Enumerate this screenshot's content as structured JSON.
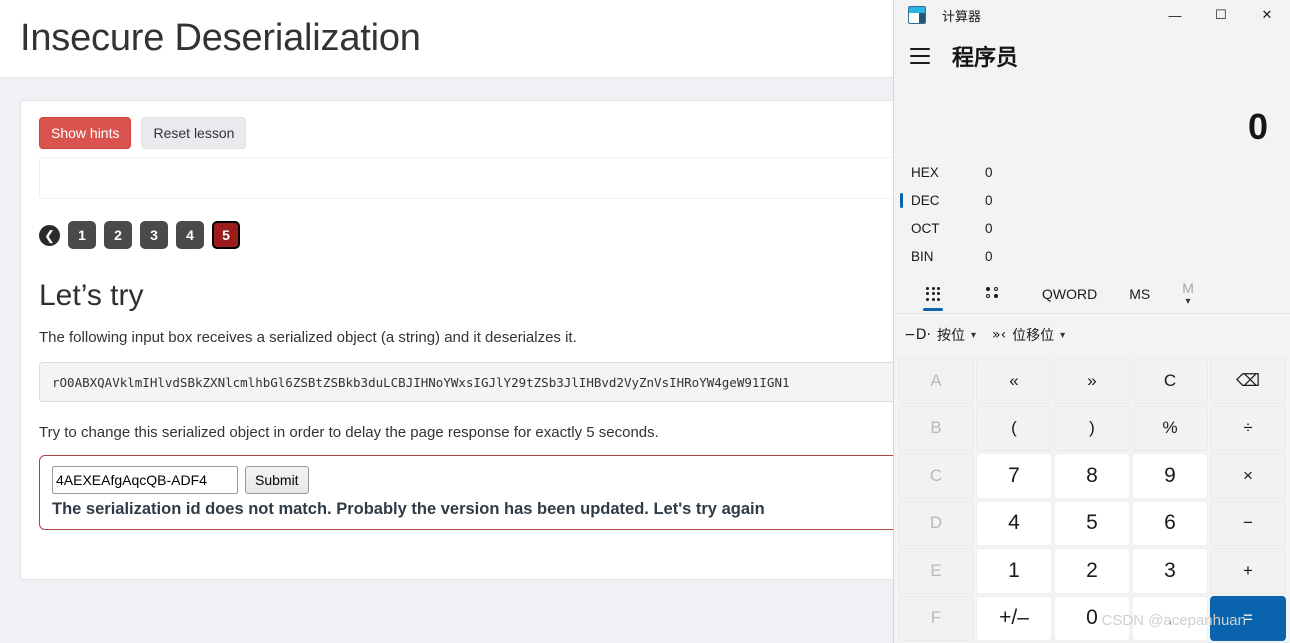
{
  "page": {
    "title": "Insecure Deserialization",
    "hints_button": "Show hints",
    "reset_button": "Reset lesson",
    "pager": {
      "back_icon": "⬅",
      "items": [
        "1",
        "2",
        "3",
        "4",
        "5"
      ],
      "active": "5"
    },
    "section_title": "Let’s try",
    "paragraph1": "The following input box receives a serialized object (a string) and it deserialzes it.",
    "serialized_object": "rO0ABXQAVklmIHlvdSBkZXNlcmlhbGl6ZSBtZSBkb3duLCBJIHNoYWxsIGJlY29tZSb3JlIHBvd2VyZnVsIHRoYW4geW91IGN1",
    "paragraph2": "Try to change this serialized object in order to delay the page response for exactly 5 seconds.",
    "attack_input_value": "4AEXEAfgAqcQB-ADF4",
    "submit_button": "Submit",
    "error_message": "The serialization id does not match. Probably the version has been updated. Let's try again",
    "accent_red": "#d9534f",
    "error_border": "#a94442"
  },
  "calculator": {
    "app_name": "计算器",
    "window_controls": {
      "minimize": "—",
      "maximize": "☐",
      "close": "✕"
    },
    "mode_label": "程序员",
    "display_value": "0",
    "radix": [
      {
        "name": "HEX",
        "value": "0",
        "active": false
      },
      {
        "name": "DEC",
        "value": "0",
        "active": true
      },
      {
        "name": "OCT",
        "value": "0",
        "active": false
      },
      {
        "name": "BIN",
        "value": "0",
        "active": false
      }
    ],
    "tabs": [
      {
        "label": "",
        "icon": "keypad-icon",
        "selected": true,
        "disabled": false
      },
      {
        "label": "",
        "icon": "bit-toggle-icon",
        "selected": false,
        "disabled": false
      },
      {
        "label": "QWORD",
        "icon": "",
        "selected": false,
        "disabled": false
      },
      {
        "label": "MS",
        "icon": "",
        "selected": false,
        "disabled": false
      },
      {
        "label": "M",
        "icon": "chevron-down-icon",
        "selected": false,
        "disabled": true
      }
    ],
    "ops": [
      {
        "label": "按位",
        "icon": "logic-gate-icon"
      },
      {
        "label": "位移位",
        "icon": "bit-shift-icon"
      }
    ],
    "keys": [
      {
        "label": "A",
        "type": "hexdim"
      },
      {
        "label": "«",
        "type": "fn"
      },
      {
        "label": "»",
        "type": "fn"
      },
      {
        "label": "C",
        "type": "fn"
      },
      {
        "label": "⌫",
        "type": "fn"
      },
      {
        "label": "B",
        "type": "hexdim"
      },
      {
        "label": "(",
        "type": "fn"
      },
      {
        "label": ")",
        "type": "fn"
      },
      {
        "label": "%",
        "type": "fn"
      },
      {
        "label": "÷",
        "type": "fn"
      },
      {
        "label": "C",
        "type": "hexdim"
      },
      {
        "label": "7",
        "type": "num"
      },
      {
        "label": "8",
        "type": "num"
      },
      {
        "label": "9",
        "type": "num"
      },
      {
        "label": "×",
        "type": "fn"
      },
      {
        "label": "D",
        "type": "hexdim"
      },
      {
        "label": "4",
        "type": "num"
      },
      {
        "label": "5",
        "type": "num"
      },
      {
        "label": "6",
        "type": "num"
      },
      {
        "label": "−",
        "type": "fn"
      },
      {
        "label": "E",
        "type": "hexdim"
      },
      {
        "label": "1",
        "type": "num"
      },
      {
        "label": "2",
        "type": "num"
      },
      {
        "label": "3",
        "type": "num"
      },
      {
        "label": "+",
        "type": "fn"
      },
      {
        "label": "F",
        "type": "hexdim"
      },
      {
        "label": "+/–",
        "type": "num"
      },
      {
        "label": "0",
        "type": "num"
      },
      {
        "label": ".",
        "type": "num"
      },
      {
        "label": "=",
        "type": "eq"
      }
    ],
    "accent_blue": "#0a64ad"
  },
  "watermark": "CSDN @acepanhuan"
}
